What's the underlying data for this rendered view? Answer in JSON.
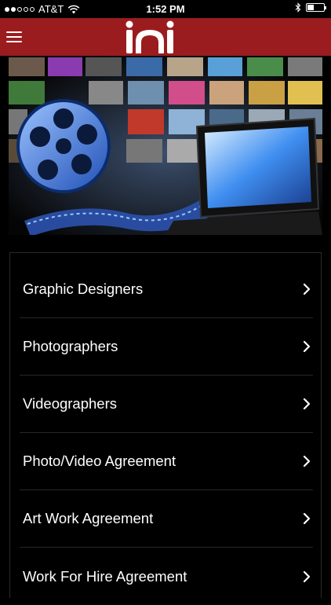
{
  "status_bar": {
    "carrier": "AT&T",
    "time": "1:52 PM",
    "signal_bars_filled": 2,
    "signal_bars_total": 5,
    "battery_level": 0.35
  },
  "nav": {
    "menu_icon": "hamburger-icon",
    "logo_icon": "app-logo-icon",
    "bar_color": "#9b1c1f"
  },
  "menu": {
    "items": [
      {
        "label": "Graphic Designers"
      },
      {
        "label": "Photographers"
      },
      {
        "label": "Videographers"
      },
      {
        "label": "Photo/Video Agreement"
      },
      {
        "label": "Art Work Agreement"
      },
      {
        "label": "Work For Hire Agreement"
      }
    ],
    "chevron_icon": "chevron-right-icon"
  }
}
